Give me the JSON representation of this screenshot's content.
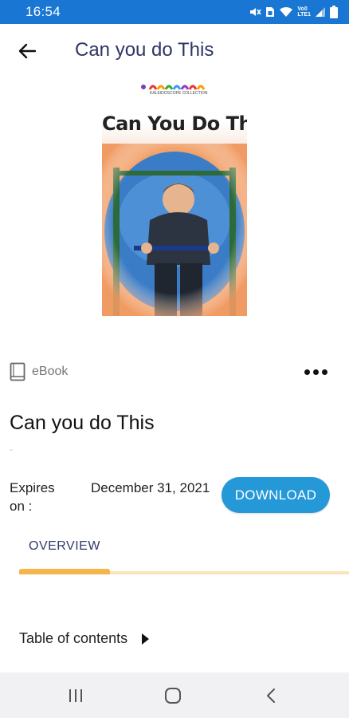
{
  "status_bar": {
    "time": "16:54",
    "network_top": "Vo0",
    "network_bottom": "LTE1",
    "icons": [
      "mute-icon",
      "sim-icon",
      "wifi-icon",
      "signal-icon",
      "battery-icon"
    ]
  },
  "header": {
    "title": "Can you do This",
    "back_icon": "arrow-left-icon"
  },
  "cover": {
    "logo_text": "KALEIDOSCOPE COLLECTION",
    "title": "Can You Do This?"
  },
  "item": {
    "type_label": "eBook",
    "type_icon": "book-icon",
    "more_icon": "more-horizontal-icon",
    "title": "Can you do This",
    "subtitle": "-",
    "expires_label": "Expires on :",
    "expires_value": "December 31, 2021",
    "download_label": "DOWNLOAD"
  },
  "tabs": [
    {
      "label": "OVERVIEW",
      "active": true
    }
  ],
  "toc": {
    "label": "Table of contents",
    "icon": "caret-right-icon"
  },
  "nav": {
    "icons": [
      "recent-apps-icon",
      "home-icon",
      "back-icon"
    ]
  },
  "colors": {
    "status_bar": "#1976d2",
    "title_text": "#2e3566",
    "download_button": "#2598d8",
    "tab_indicator": "#f5b54a",
    "tab_track": "#fbe3b8",
    "nav_bar": "#f1f1f3"
  }
}
